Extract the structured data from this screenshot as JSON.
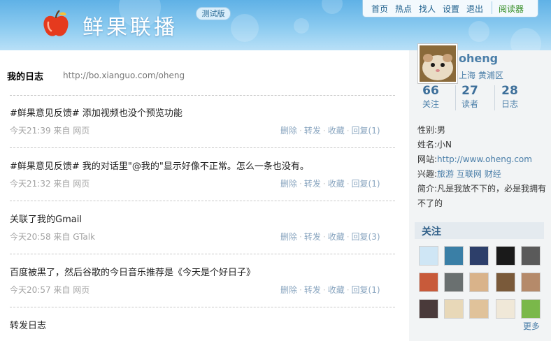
{
  "header": {
    "site_title": "鲜果联播",
    "beta_badge": "测试版",
    "nav": [
      "首页",
      "热点",
      "找人",
      "设置",
      "退出"
    ],
    "reader_link": "阅读器",
    "colors": {
      "brand_blue": "#5fb1e6",
      "reader_green": "#2f8a1f"
    }
  },
  "main": {
    "heading": "我的日志",
    "url": "http://bo.xianguo.com/oheng",
    "entries": [
      {
        "text": "#鲜果意见反馈# 添加视频也没个预览功能",
        "meta": "今天21:39 来自 网页",
        "delete": "删除",
        "forward": "转发",
        "favorite": "收藏",
        "reply": "回复(1)"
      },
      {
        "text": "#鲜果意见反馈# 我的对话里\"@我的\"显示好像不正常。怎么一条也没有。",
        "meta": "今天21:32 来自 网页",
        "delete": "删除",
        "forward": "转发",
        "favorite": "收藏",
        "reply": "回复(1)"
      },
      {
        "text": "关联了我的Gmail",
        "meta": "今天20:58 来自 GTalk",
        "delete": "删除",
        "forward": "转发",
        "favorite": "收藏",
        "reply": "回复(3)"
      },
      {
        "text": "百度被黑了，然后谷歌的今日音乐推荐是《今天是个好日子》",
        "meta": "今天20:57 来自 网页",
        "delete": "删除",
        "forward": "转发",
        "favorite": "收藏",
        "reply": "回复(1)"
      },
      {
        "text": "转发日志"
      }
    ]
  },
  "sidebar": {
    "username": "oheng",
    "location": "上海 黄浦区",
    "stats": [
      {
        "count": "66",
        "label": "关注"
      },
      {
        "count": "27",
        "label": "读者"
      },
      {
        "count": "28",
        "label": "日志"
      }
    ],
    "gender": "性别:男",
    "realname": "姓名:小N",
    "website_label": "网站:",
    "website": "http://www.oheng.com",
    "interests_label": "兴趣:",
    "interest1": "旅游",
    "interest2": "互联网",
    "interest3": "财经",
    "bio": "简介:凡是我放不下的，必是我拥有不了的",
    "following_title": "关注",
    "more": "更多"
  }
}
